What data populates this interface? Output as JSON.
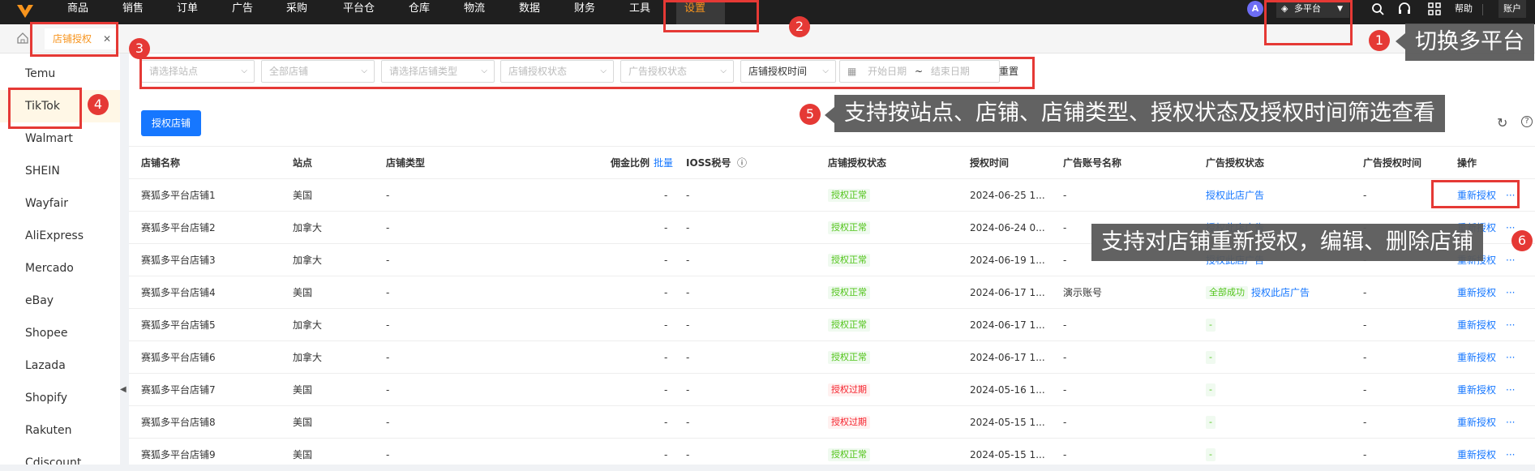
{
  "nav": {
    "items": [
      "商品",
      "销售",
      "订单",
      "广告",
      "采购",
      "平台仓",
      "仓库",
      "物流",
      "数据",
      "财务",
      "工具",
      "设置"
    ],
    "platform_label": "多平台",
    "help_label": "帮助",
    "account_label": "账户",
    "avatar_letter": "A"
  },
  "tabs": {
    "current": "店铺授权"
  },
  "sidebar": {
    "items": [
      "Temu",
      "TikTok",
      "Walmart",
      "SHEIN",
      "Wayfair",
      "AliExpress",
      "Mercado",
      "eBay",
      "Shopee",
      "Lazada",
      "Shopify",
      "Rakuten",
      "Cdiscount"
    ]
  },
  "filters": {
    "site": "请选择站点",
    "store": "全部店铺",
    "store_type": "请选择店铺类型",
    "auth_status": "店铺授权状态",
    "ad_auth_status": "广告授权状态",
    "time_type": "店铺授权时间",
    "start_date": "开始日期",
    "tilde": "~",
    "end_date": "结束日期",
    "reset": "重置"
  },
  "actions": {
    "authorize_store": "授权店铺"
  },
  "table": {
    "headers": [
      "店铺名称",
      "站点",
      "店铺类型",
      "佣金比例",
      "批量",
      "IOSS税号",
      "店铺授权状态",
      "授权时间",
      "广告账号名称",
      "广告授权状态",
      "广告授权时间",
      "操作"
    ],
    "rows": [
      {
        "name": "赛狐多平台店铺1",
        "site": "美国",
        "type": "-",
        "commission": "-",
        "ioss": "-",
        "status": "授权正常",
        "time": "2024-06-25 1...",
        "ad_account": "-",
        "ad_status": "授权此店广告",
        "ad_time": "-",
        "op": "重新授权"
      },
      {
        "name": "赛狐多平台店铺2",
        "site": "加拿大",
        "type": "-",
        "commission": "-",
        "ioss": "-",
        "status": "授权正常",
        "time": "2024-06-24 0...",
        "ad_account": "-",
        "ad_status": "授权此店广告",
        "ad_time": "-",
        "op": "重新授权"
      },
      {
        "name": "赛狐多平台店铺3",
        "site": "加拿大",
        "type": "-",
        "commission": "-",
        "ioss": "-",
        "status": "授权正常",
        "time": "2024-06-19 1...",
        "ad_account": "-",
        "ad_status": "授权此店广告",
        "ad_time": "-",
        "op": "重新授权"
      },
      {
        "name": "赛狐多平台店铺4",
        "site": "美国",
        "type": "-",
        "commission": "-",
        "ioss": "-",
        "status": "授权正常",
        "time": "2024-06-17 1...",
        "ad_account": "演示账号",
        "ad_status_tag": "全部成功",
        "ad_status": "授权此店广告",
        "ad_time": "-",
        "op": "重新授权"
      },
      {
        "name": "赛狐多平台店铺5",
        "site": "加拿大",
        "type": "-",
        "commission": "-",
        "ioss": "-",
        "status": "授权正常",
        "time": "2024-06-17 1...",
        "ad_account": "-",
        "ad_status": "-",
        "ad_time": "-",
        "op": "重新授权"
      },
      {
        "name": "赛狐多平台店铺6",
        "site": "加拿大",
        "type": "-",
        "commission": "-",
        "ioss": "-",
        "status": "授权正常",
        "time": "2024-06-17 1...",
        "ad_account": "-",
        "ad_status": "-",
        "ad_time": "-",
        "op": "重新授权"
      },
      {
        "name": "赛狐多平台店铺7",
        "site": "美国",
        "type": "-",
        "commission": "-",
        "ioss": "-",
        "status": "授权过期",
        "time": "2024-05-16 1...",
        "ad_account": "-",
        "ad_status": "-",
        "ad_time": "-",
        "op": "重新授权"
      },
      {
        "name": "赛狐多平台店铺8",
        "site": "美国",
        "type": "-",
        "commission": "-",
        "ioss": "-",
        "status": "授权过期",
        "time": "2024-05-15 1...",
        "ad_account": "-",
        "ad_status": "-",
        "ad_time": "-",
        "op": "重新授权"
      },
      {
        "name": "赛狐多平台店铺9",
        "site": "美国",
        "type": "-",
        "commission": "-",
        "ioss": "-",
        "status": "授权正常",
        "time": "2024-05-15 1...",
        "ad_account": "-",
        "ad_status": "-",
        "ad_time": "-",
        "op": "重新授权"
      }
    ],
    "more": "···"
  },
  "annotations": {
    "n1": "1",
    "n2": "2",
    "n3": "3",
    "n4": "4",
    "n5": "5",
    "n6": "6",
    "tip1": "切换多平台",
    "tip5": "支持按站点、店铺、店铺类型、授权状态及授权时间筛选查看",
    "tip6": "支持对店铺重新授权，编辑、删除店铺"
  },
  "colors": {
    "accent": "#f7941d",
    "primary": "#1677ff",
    "annotation": "#e53935",
    "ok": "#52c41a",
    "bad": "#f5222d"
  }
}
